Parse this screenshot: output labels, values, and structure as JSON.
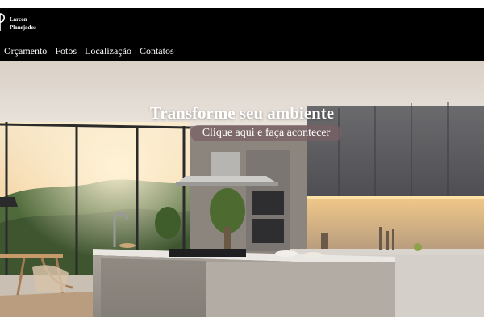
{
  "brand": {
    "line1": "Larcon",
    "line2": "Planejados",
    "logo_icon": "logo-mark"
  },
  "nav": {
    "items": [
      {
        "label": "Orçamento"
      },
      {
        "label": "Fotos"
      },
      {
        "label": "Localização"
      },
      {
        "label": "Contatos"
      }
    ]
  },
  "hero": {
    "title": "Transforme seu ambiente",
    "cta": "Clique aqui e faça acontecer",
    "image": "kitchen-photo"
  },
  "colors": {
    "header_bg": "#000000",
    "text": "#ffffff",
    "cta_bg": "#785f64"
  }
}
